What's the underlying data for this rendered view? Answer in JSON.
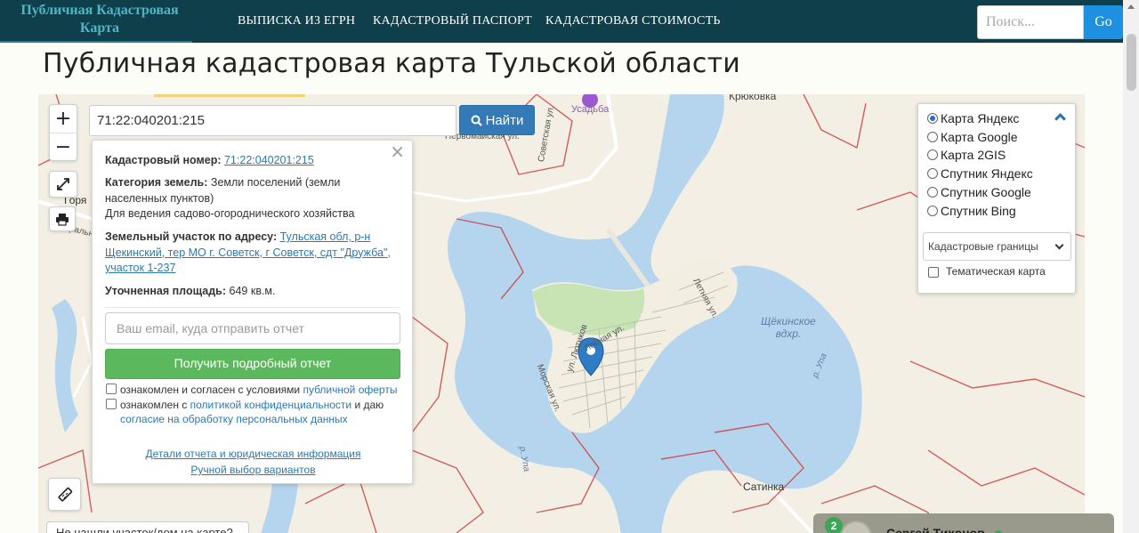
{
  "header": {
    "brand": "Публичная Кадастровая Карта",
    "nav": [
      "ВЫПИСКА ИЗ ЕГРН",
      "КАДАСТРОВЫЙ ПАСПОРТ",
      "КАДАСТРОВАЯ СТОИМОСТЬ"
    ],
    "search_placeholder": "Поиск...",
    "go_label": "Go"
  },
  "page_title": "Публичная кадастровая карта Тульской области",
  "map_controls": {
    "zoom_in": "+",
    "zoom_out": "−",
    "cadastral_input_value": "71:22:040201:215",
    "find_label": "Найти"
  },
  "info_panel": {
    "cadastral_number_label": "Кадастровый номер:",
    "cadastral_number": "71:22:040201:215",
    "land_category_label": "Категория земель:",
    "land_category_value": "Земли поселений (земли населенных пунктов)",
    "land_use": "Для ведения садово-огороднического хозяйства",
    "address_label": "Земельный участок по адресу:",
    "address_value": "Тульская обл, р-н Щекинский, тер МО г. Советск, г Советск, сдт \"Дружба\", участок 1-237",
    "area_label": "Уточненная площадь:",
    "area_value": "649 кв.м.",
    "email_placeholder": "Ваш email, куда отправить отчет",
    "report_button": "Получить подробный отчет",
    "agree_offer_text": "ознакомлен и согласен с условиями",
    "agree_offer_link": "публичной оферты",
    "agree_privacy_text_1": "ознакомлен с",
    "agree_privacy_link": "политикой конфиденциальности",
    "agree_privacy_text_2": "и даю",
    "agree_privacy_link_2": "согласие на обработку персональных данных",
    "details_link": "Детали отчета и юридическая информация",
    "manual_link": "Ручной выбор вариантов"
  },
  "layers_panel": {
    "options": [
      "Карта Яндекс",
      "Карта Google",
      "Карта 2GIS",
      "Спутник Яндекс",
      "Спутник Google",
      "Спутник Bing"
    ],
    "selected": "Карта Яндекс",
    "overlay_select": "Кадастровые границы",
    "thematic_label": "Тематическая карта"
  },
  "map_labels": {
    "krukovka": "Крюковка",
    "usadba": "Усадьба",
    "pervomayskaya": "Первомайская ул.",
    "sovetskaya": "Советская ул.",
    "letnyaya": "Летняя ул.",
    "lesnaya": "Лесная ул.",
    "lyutikov": "ул. Лютиков",
    "morskaya": "Морская ул.",
    "reservoir": "Щёкинское вдхр.",
    "river_upa": "р. Упа",
    "satinka": "Сатинка",
    "gor": "Горя",
    "tsentral": "Центральная"
  },
  "bottom": {
    "not_found": "Не нашли участок/дом на карте?",
    "chat_badge": "2",
    "chat_name": "Сергей Тихонов"
  },
  "colors": {
    "navbar": "#0e3f4a",
    "water": "#b5d4ee",
    "accent_blue": "#337ab7",
    "green_button": "#5cb85c",
    "boundary": "#cc4444"
  }
}
